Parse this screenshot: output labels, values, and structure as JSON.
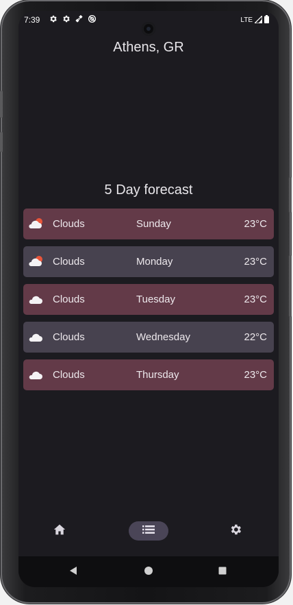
{
  "status_bar": {
    "time": "7:39",
    "network": "LTE",
    "icons": [
      "gear-icon",
      "gear-icon",
      "satellite-icon",
      "no-disturb-icon"
    ]
  },
  "location": {
    "city": "Athens, GR"
  },
  "forecast": {
    "title": "5 Day forecast",
    "days": [
      {
        "condition": "Clouds",
        "day": "Sunday",
        "temp": "23°C",
        "icon": "partly-cloudy-icon",
        "color": "#633a48"
      },
      {
        "condition": "Clouds",
        "day": "Monday",
        "temp": "23°C",
        "icon": "partly-cloudy-icon",
        "color": "#47424f"
      },
      {
        "condition": "Clouds",
        "day": "Tuesday",
        "temp": "23°C",
        "icon": "cloud-icon",
        "color": "#633a48"
      },
      {
        "condition": "Clouds",
        "day": "Wednesday",
        "temp": "22°C",
        "icon": "cloud-icon",
        "color": "#47424f"
      },
      {
        "condition": "Clouds",
        "day": "Thursday",
        "temp": "23°C",
        "icon": "cloud-icon",
        "color": "#633a48"
      }
    ]
  },
  "bottom_nav": {
    "items": [
      {
        "icon": "home-icon",
        "selected": false
      },
      {
        "icon": "list-icon",
        "selected": true
      },
      {
        "icon": "settings-icon",
        "selected": false
      }
    ]
  },
  "system_nav": {
    "items": [
      "back-icon",
      "home-circle-icon",
      "recents-icon"
    ]
  },
  "colors": {
    "background": "#1c1b20",
    "row_red": "#633a48",
    "row_purple": "#47424f",
    "nav_indicator": "#4a4557"
  }
}
